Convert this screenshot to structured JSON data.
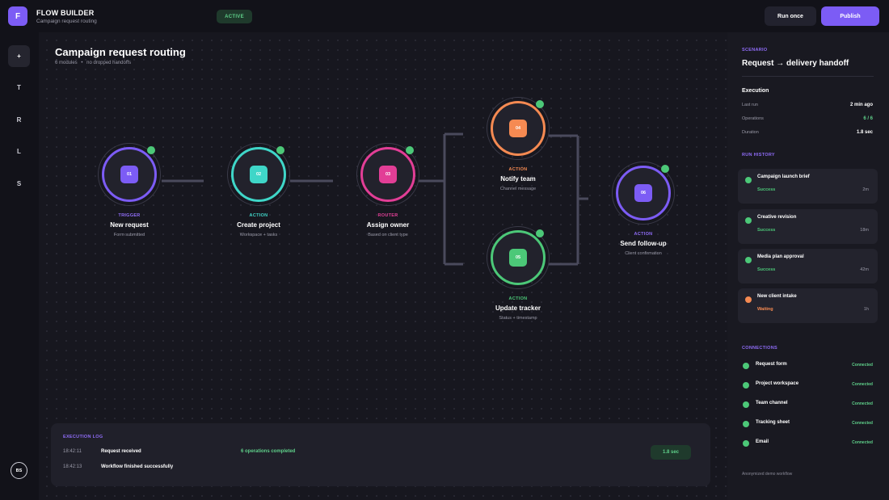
{
  "header": {
    "logo_letter": "F",
    "app_title": "FLOW BUILDER",
    "app_subtitle": "Campaign request routing",
    "status": "ACTIVE",
    "run_once_label": "Run once",
    "publish_label": "Publish"
  },
  "rail": {
    "active_item": "+",
    "items": [
      "T",
      "R",
      "L",
      "S"
    ],
    "avatar_initials": "BS"
  },
  "canvas": {
    "title": "Campaign request routing",
    "meta_modules": "6 modules",
    "meta_separator": "•",
    "meta_handoffs": "no dropped handoffs"
  },
  "nodes": [
    {
      "id": "01",
      "kind": "TRIGGER",
      "name": "New request",
      "desc": "Form submitted",
      "color": "#7c5cf5"
    },
    {
      "id": "02",
      "kind": "ACTION",
      "name": "Create project",
      "desc": "Workspace + tasks",
      "color": "#3fd6c8"
    },
    {
      "id": "03",
      "kind": "ROUTER",
      "name": "Assign owner",
      "desc": "Based on client type",
      "color": "#e23e96"
    },
    {
      "id": "04",
      "kind": "ACTION",
      "name": "Notify team",
      "desc": "Channel message",
      "color": "#f58a52"
    },
    {
      "id": "05",
      "kind": "ACTION",
      "name": "Update tracker",
      "desc": "Status + timestamp",
      "color": "#4cc878"
    },
    {
      "id": "06",
      "kind": "ACTION",
      "name": "Send follow-up",
      "desc": "Client confirmation",
      "color": "#7c5cf5"
    }
  ],
  "log": {
    "title": "EXECUTION LOG",
    "entries": [
      {
        "time": "18:42:11",
        "message": "Request received"
      },
      {
        "time": "18:42:13",
        "message": "Workflow finished successfully"
      }
    ],
    "operations": "6 operations completed",
    "duration_badge": "1.8 sec"
  },
  "panel": {
    "scenario_label": "SCENARIO",
    "scenario_title": "Request → delivery handoff",
    "execution_heading": "Execution",
    "execution": [
      {
        "key": "Last run",
        "value": "2 min ago",
        "color": "#ffffff"
      },
      {
        "key": "Operations",
        "value": "6 / 6",
        "color": "#5fd08a"
      },
      {
        "key": "Duration",
        "value": "1.8 sec",
        "color": "#ffffff"
      }
    ],
    "run_history_label": "RUN HISTORY",
    "runs": [
      {
        "name": "Campaign launch brief",
        "status": "Success",
        "time": "2m",
        "color": "#4cc878"
      },
      {
        "name": "Creative revision",
        "status": "Success",
        "time": "18m",
        "color": "#4cc878"
      },
      {
        "name": "Media plan approval",
        "status": "Success",
        "time": "42m",
        "color": "#4cc878"
      },
      {
        "name": "New client intake",
        "status": "Waiting",
        "time": "1h",
        "color": "#f58a52"
      }
    ],
    "connections_label": "CONNECTIONS",
    "connections": [
      {
        "name": "Request form",
        "status": "Connected"
      },
      {
        "name": "Project workspace",
        "status": "Connected"
      },
      {
        "name": "Team channel",
        "status": "Connected"
      },
      {
        "name": "Tracking sheet",
        "status": "Connected"
      },
      {
        "name": "Email",
        "status": "Connected"
      }
    ],
    "footer": "Anonymized demo workflow"
  }
}
